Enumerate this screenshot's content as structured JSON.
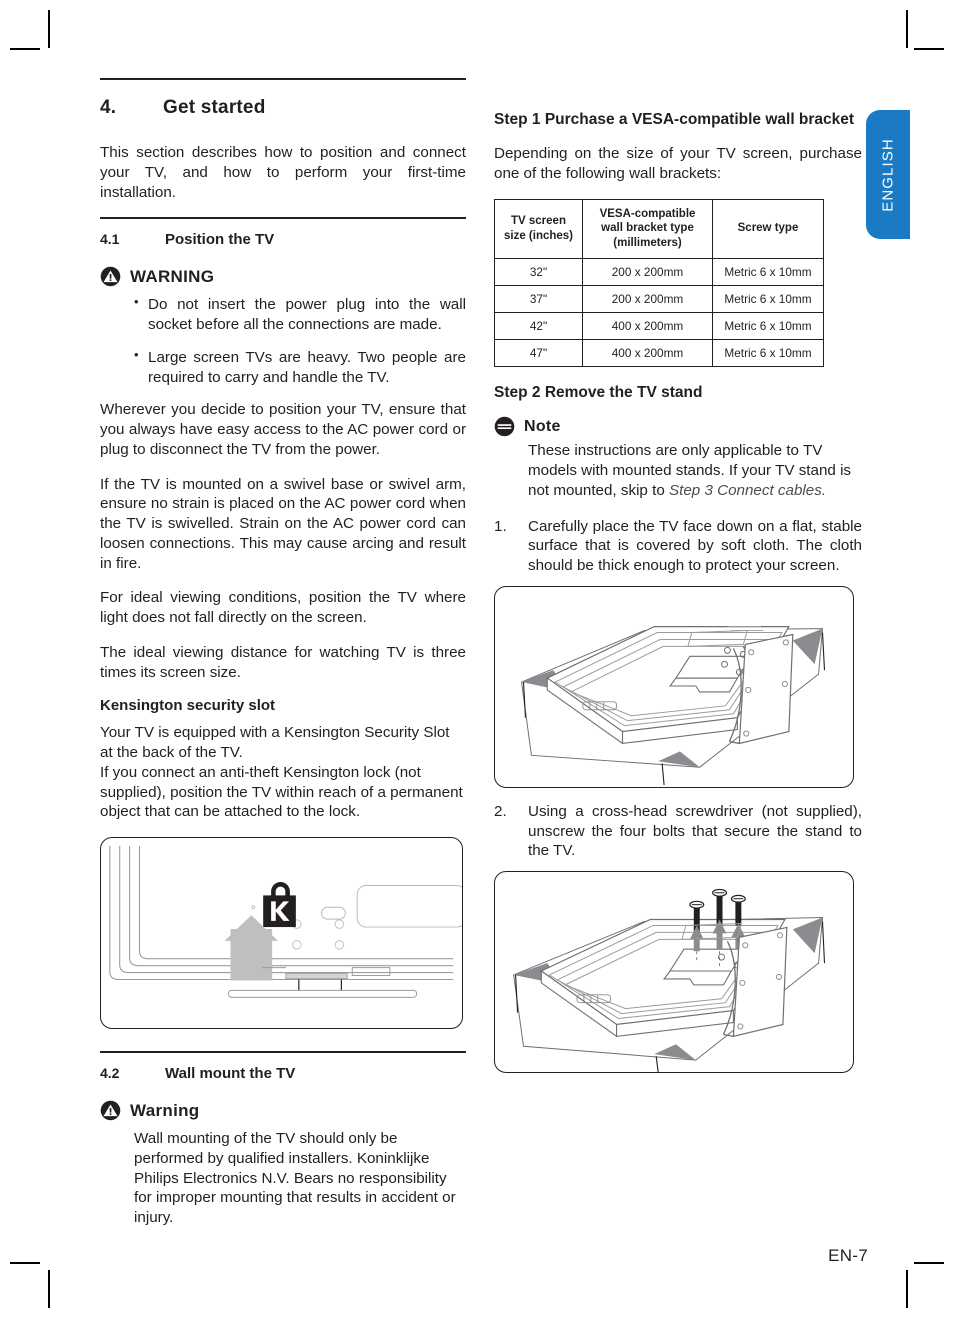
{
  "language_tab": {
    "label": "ENGLISH",
    "color": "#1a7ac3"
  },
  "footer": {
    "page_number": "EN-7"
  },
  "left_column": {
    "section": {
      "number": "4.",
      "title": "Get started"
    },
    "intro": "This section describes how to position and connect your TV, and how to perform your first-time installation.",
    "subsection_1": {
      "number": "4.1",
      "title": "Position the TV"
    },
    "warning_1": {
      "icon": "warning-triangle-icon",
      "label": "WARNING",
      "bullets": [
        "Do not insert the power plug into the wall socket before all the connections are made.",
        "Large screen TVs are heavy.  Two people are required to carry and handle the TV."
      ]
    },
    "paragraphs": [
      "Wherever you decide to position your TV, ensure that you always have easy access to the AC power cord or plug to disconnect the TV from the power.",
      "If the TV is mounted on a swivel base or swivel arm, ensure no strain is placed on the AC power cord when the TV is swivelled.  Strain on the AC power cord can loosen connections.  This may cause arcing and result in fire.",
      "For ideal viewing conditions, position the TV where light does not fall directly on the screen.",
      "The ideal viewing distance for watching TV is three times its screen size."
    ],
    "kensington": {
      "heading": "Kensington security slot",
      "body": "Your TV is equipped with a Kensington Security Slot at the back of the TV.\nIf you connect an anti-theft Kensington lock (not supplied), position the TV within reach of a permanent object that can be attached to the lock."
    },
    "figure_kensington": {
      "name": "tv-back-panel-kensington-slot-diagram"
    },
    "subsection_2": {
      "number": "4.2",
      "title": "Wall mount the TV"
    },
    "warning_2": {
      "icon": "warning-triangle-icon",
      "label": "Warning",
      "body": "Wall mounting of the TV should only be performed by qualified installers. Koninklijke Philips Electronics N.V. Bears no responsibility for improper mounting that results in accident or injury."
    }
  },
  "right_column": {
    "step1": {
      "heading": "Step 1 Purchase a VESA-compatible wall bracket",
      "intro": "Depending on the size of your TV screen, purchase one of the following wall brackets:",
      "table": {
        "headers": [
          "TV screen\nsize (inches)",
          "VESA-compatible\nwall bracket type\n(millimeters)",
          "Screw type"
        ],
        "rows": [
          [
            "32\"",
            "200 x 200mm",
            "Metric 6 x 10mm"
          ],
          [
            "37\"",
            "200 x 200mm",
            "Metric 6 x 10mm"
          ],
          [
            "42\"",
            "400 x 200mm",
            "Metric 6 x 10mm"
          ],
          [
            "47\"",
            "400 x 200mm",
            "Metric 6 x 10mm"
          ]
        ]
      }
    },
    "step2": {
      "heading": "Step 2 Remove the TV stand",
      "note": {
        "icon": "note-icon",
        "label": "Note",
        "body_plain": "These instructions are only applicable to TV models with mounted stands. If your TV stand is not mounted, skip to ",
        "body_italic": "Step 3 Connect cables."
      },
      "instructions": [
        {
          "number": "1.",
          "text": "Carefully place the TV face down on a flat, stable surface that is covered by soft cloth. The cloth should be thick enough to protect your screen."
        },
        {
          "number": "2.",
          "text": "Using a cross-head screwdriver (not supplied), unscrew the four bolts that secure the stand to the TV."
        }
      ],
      "figure_1": {
        "name": "tv-face-down-on-cloth-diagram"
      },
      "figure_2": {
        "name": "tv-stand-bolts-unscrew-diagram"
      }
    }
  }
}
